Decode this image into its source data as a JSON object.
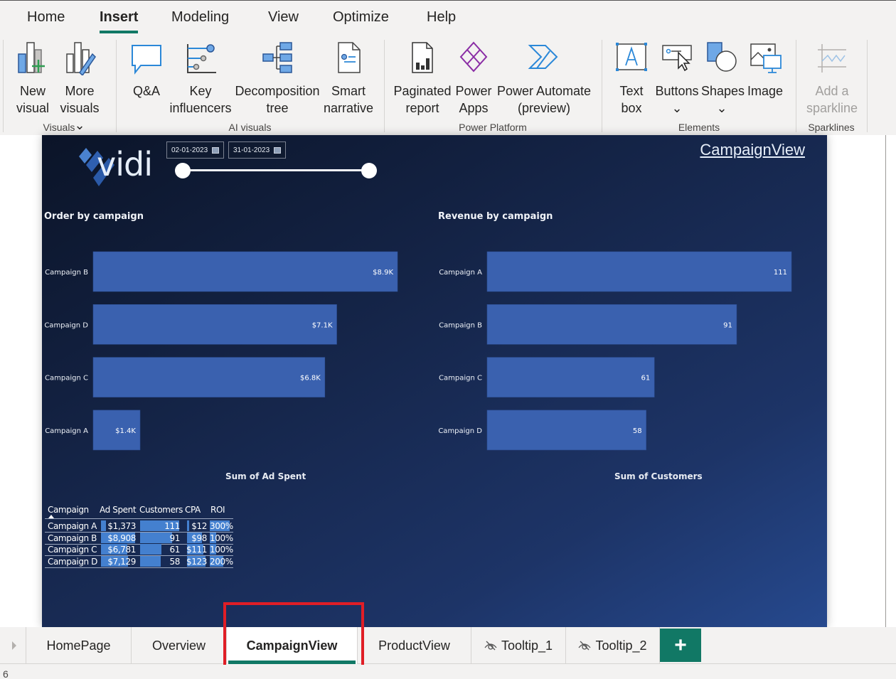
{
  "ribbon": {
    "tabs": [
      "Home",
      "Insert",
      "Modeling",
      "View",
      "Optimize",
      "Help"
    ],
    "active_tab": "Insert",
    "groups": {
      "visuals": {
        "label": "Visuals",
        "buttons": [
          {
            "line1": "New",
            "line2": "visual",
            "icon": "new-visual-icon"
          },
          {
            "line1": "More",
            "line2": "visuals ⌄",
            "icon": "more-visuals-icon"
          }
        ]
      },
      "ai_visuals": {
        "label": "AI visuals",
        "buttons": [
          {
            "line1": "Q&A",
            "line2": "",
            "icon": "qna-icon"
          },
          {
            "line1": "Key",
            "line2": "influencers",
            "icon": "key-influencers-icon"
          },
          {
            "line1": "Decomposition",
            "line2": "tree",
            "icon": "decomposition-tree-icon"
          },
          {
            "line1": "Smart",
            "line2": "narrative",
            "icon": "smart-narrative-icon"
          }
        ]
      },
      "power_platform": {
        "label": "Power Platform",
        "buttons": [
          {
            "line1": "Paginated",
            "line2": "report",
            "icon": "paginated-report-icon"
          },
          {
            "line1": "Power",
            "line2": "Apps",
            "icon": "power-apps-icon"
          },
          {
            "line1": "Power Automate",
            "line2": "(preview)",
            "icon": "power-automate-icon"
          }
        ]
      },
      "elements": {
        "label": "Elements",
        "buttons": [
          {
            "line1": "Text",
            "line2": "box",
            "icon": "text-box-icon"
          },
          {
            "line1": "Buttons",
            "line2": "⌄",
            "icon": "buttons-icon"
          },
          {
            "line1": "Shapes",
            "line2": "⌄",
            "icon": "shapes-icon"
          },
          {
            "line1": "Image",
            "line2": "",
            "icon": "image-icon"
          }
        ]
      },
      "sparklines": {
        "label": "Sparklines",
        "buttons": [
          {
            "line1": "Add a",
            "line2": "sparkline",
            "icon": "sparkline-icon",
            "disabled": true
          }
        ]
      }
    }
  },
  "report": {
    "logo_text": "vidi",
    "date_slicer": {
      "start": "02-01-2023",
      "end": "31-01-2023",
      "range_fraction": [
        0,
        1
      ]
    },
    "page_link": "CampaignView",
    "colors": {
      "bar": "#3a61af",
      "table_bar": "#4480cf",
      "accent": "#117865"
    }
  },
  "chart_data": [
    {
      "type": "bar",
      "orientation": "horizontal",
      "title": "Order by campaign",
      "xlabel": "Sum of Ad Spent",
      "ylabel": "",
      "categories": [
        "Campaign B",
        "Campaign D",
        "Campaign C",
        "Campaign A"
      ],
      "values": [
        8908,
        7129,
        6781,
        1373
      ],
      "labels": [
        "$8.9K",
        "$7.1K",
        "$6.8K",
        "$1.4K"
      ],
      "xlim": [
        0,
        8908
      ],
      "grid": false
    },
    {
      "type": "bar",
      "orientation": "horizontal",
      "title": "Revenue by campaign",
      "xlabel": "Sum of Customers",
      "ylabel": "",
      "categories": [
        "Campaign A",
        "Campaign B",
        "Campaign C",
        "Campaign D"
      ],
      "values": [
        111,
        91,
        61,
        58
      ],
      "labels": [
        "111",
        "91",
        "61",
        "58"
      ],
      "xlim": [
        0,
        111
      ],
      "grid": false
    }
  ],
  "table": {
    "columns": [
      "Campaign",
      "Ad Spent",
      "Customers",
      "CPA",
      "ROI"
    ],
    "sort_column": "Campaign",
    "rows": [
      {
        "campaign": "Campaign A",
        "ad_spent": "$1,373",
        "ad_spent_v": 1373,
        "customers": "111",
        "customers_v": 111,
        "cpa": "$12",
        "cpa_v": 12,
        "roi": "300%",
        "roi_v": 300
      },
      {
        "campaign": "Campaign B",
        "ad_spent": "$8,908",
        "ad_spent_v": 8908,
        "customers": "91",
        "customers_v": 91,
        "cpa": "$98",
        "cpa_v": 98,
        "roi": "100%",
        "roi_v": 100
      },
      {
        "campaign": "Campaign C",
        "ad_spent": "$6,781",
        "ad_spent_v": 6781,
        "customers": "61",
        "customers_v": 61,
        "cpa": "$111",
        "cpa_v": 111,
        "roi": "100%",
        "roi_v": 100
      },
      {
        "campaign": "Campaign D",
        "ad_spent": "$7,129",
        "ad_spent_v": 7129,
        "customers": "58",
        "customers_v": 58,
        "cpa": "$123",
        "cpa_v": 123,
        "roi": "200%",
        "roi_v": 200
      }
    ]
  },
  "page_tabs": {
    "items": [
      {
        "label": "HomePage",
        "hidden": false
      },
      {
        "label": "Overview",
        "hidden": false
      },
      {
        "label": "CampaignView",
        "hidden": false,
        "active": true
      },
      {
        "label": "ProductView",
        "hidden": false
      },
      {
        "label": "Tooltip_1",
        "hidden": true
      },
      {
        "label": "Tooltip_2",
        "hidden": true
      }
    ],
    "add_label": "+"
  },
  "status": {
    "page_indicator": "6"
  }
}
